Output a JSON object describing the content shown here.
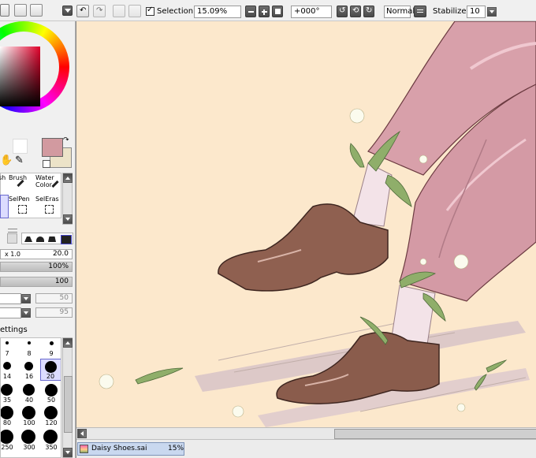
{
  "toolbar": {
    "selection_label": "Selection",
    "selection_checked": true,
    "zoom_value": "15.09%",
    "rotation_value": "+000°",
    "blend_mode": "Normal",
    "stabilizer_label": "Stabilizer",
    "stabilizer_value": "10"
  },
  "left_panel": {
    "color_swatch_primary": "#d29aa0",
    "color_swatch_secondary": "#ece3c8",
    "tools": [
      {
        "label": "sh"
      },
      {
        "label": "Brush"
      },
      {
        "label": "Water Color",
        "label_line1": "Water",
        "label_line2": "Color"
      },
      {
        "label": "SelPen"
      },
      {
        "label": "SelEras"
      }
    ],
    "size_multiplier": "x 1.0",
    "size_value": "20.0",
    "density_value": "100%",
    "min_size_value": "100",
    "field_a_value": "50",
    "field_b_value": "95",
    "settings_label": "ettings",
    "brush_sizes": [
      "7",
      "8",
      "9",
      "14",
      "16",
      "20",
      "35",
      "40",
      "50",
      "80",
      "100",
      "120",
      "250",
      "300",
      "350"
    ]
  },
  "document_tab": {
    "title": "Daisy Shoes.sai",
    "zoom": "15%"
  },
  "colors": {
    "canvas_background": "#fce8cc",
    "pants": "#d8a0aa",
    "shoes": "#8f6050",
    "accent_selection": "#3a6ea5"
  }
}
